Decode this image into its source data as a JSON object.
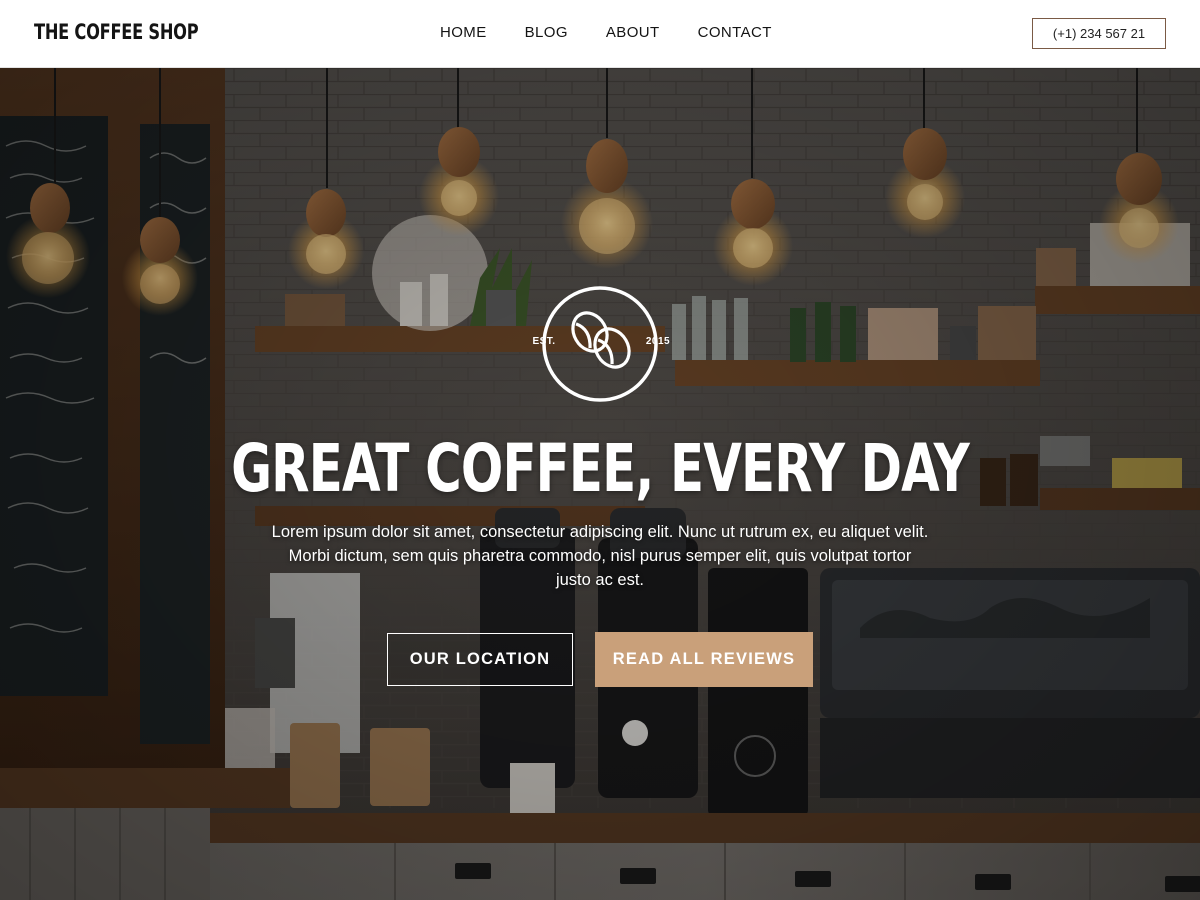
{
  "brand": {
    "name": "THE COFFEE SHOP"
  },
  "nav": {
    "items": [
      {
        "label": "HOME"
      },
      {
        "label": "BLOG"
      },
      {
        "label": "ABOUT"
      },
      {
        "label": "CONTACT"
      }
    ]
  },
  "header": {
    "phone": "(+1) 234 567 21"
  },
  "hero": {
    "badge": {
      "left": "EST.",
      "right": "2015"
    },
    "headline": "GREAT COFFEE, EVERY DAY",
    "text": "Lorem ipsum dolor sit amet, consectetur adipiscing elit. Nunc ut rutrum ex, eu aliquet velit. Morbi dictum, sem quis pharetra commodo, nisl purus semper elit, quis volutpat tortor justo ac est.",
    "buttons": {
      "location": "OUR LOCATION",
      "reviews": "READ ALL REVIEWS"
    },
    "accent_color": "#c9a07a"
  }
}
